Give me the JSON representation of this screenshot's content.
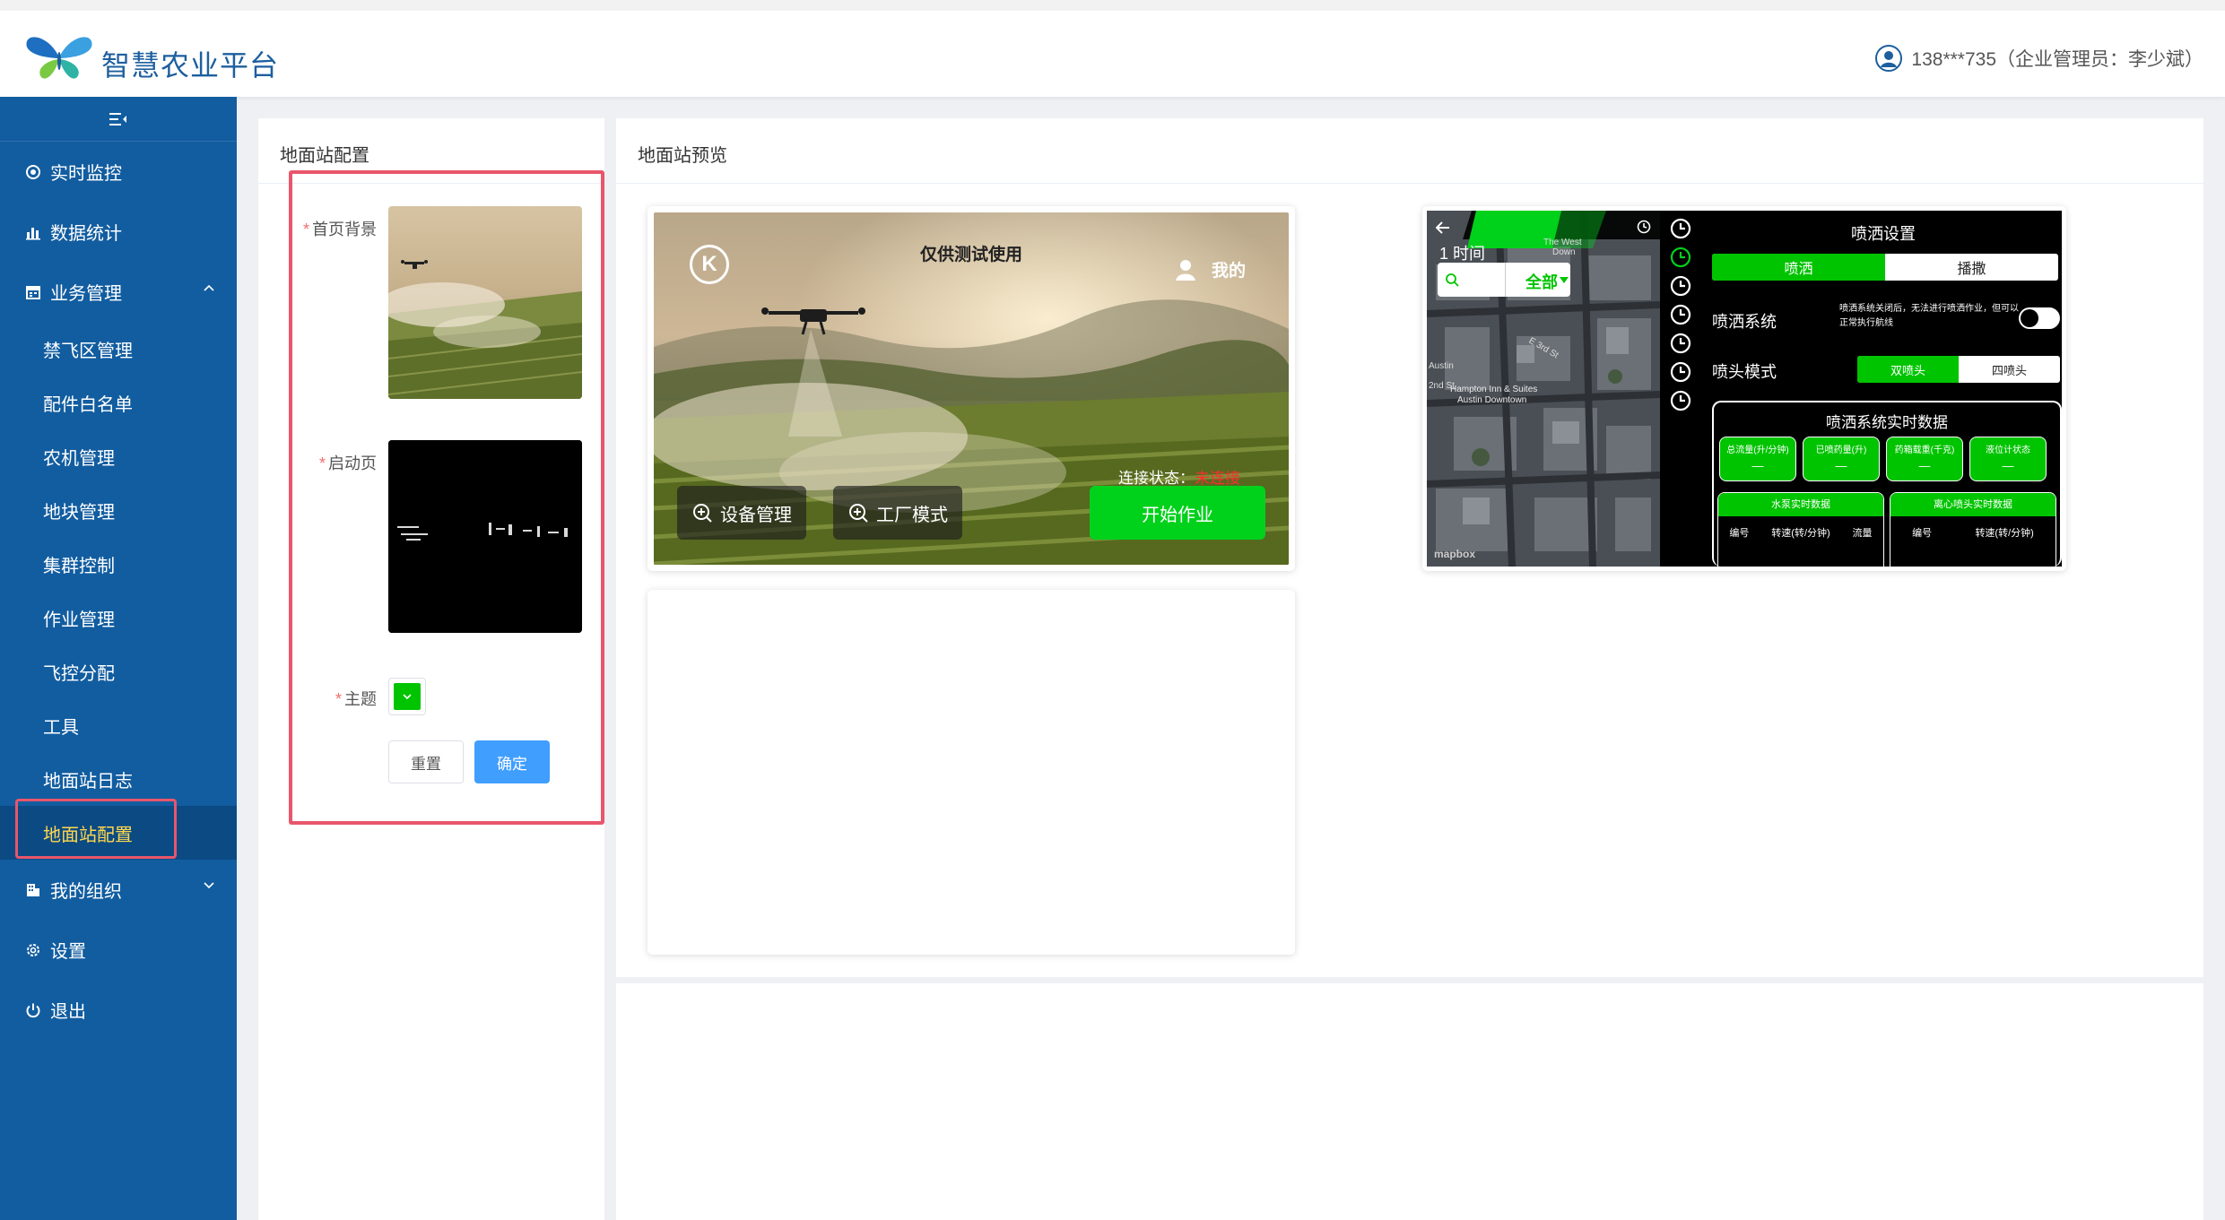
{
  "header": {
    "app_title": "智慧农业平台",
    "user_info": "138***735（企业管理员：李少斌）"
  },
  "sidebar": {
    "menu": [
      {
        "label": "实时监控",
        "icon": "monitor-icon"
      },
      {
        "label": "数据统计",
        "icon": "bar-chart-icon"
      },
      {
        "label": "业务管理",
        "icon": "calendar-icon"
      }
    ],
    "sub_items": [
      "禁飞区管理",
      "配件白名单",
      "农机管理",
      "地块管理",
      "集群控制",
      "作业管理",
      "飞控分配",
      "工具",
      "地面站日志",
      "地面站配置"
    ],
    "active": "地面站配置",
    "bottom_menu": [
      {
        "label": "我的组织",
        "icon": "org-icon"
      },
      {
        "label": "设置",
        "icon": "gear-icon"
      },
      {
        "label": "退出",
        "icon": "power-icon"
      }
    ]
  },
  "config_panel": {
    "title": "地面站配置",
    "home_bg_label": "首页背景",
    "splash_label": "启动页",
    "theme_label": "主题",
    "theme_color": "#00c400",
    "reset_button": "重置",
    "confirm_button": "确定"
  },
  "preview_panel": {
    "title": "地面站预览",
    "preview1": {
      "title": "仅供测试使用",
      "mine": "我的",
      "connection_label": "连接状态：",
      "connection_value": "未连接",
      "device_mgmt": "设备管理",
      "factory_mode": "工厂模式",
      "start_button": "开始作业"
    },
    "preview2": {
      "time_label": "1 时间",
      "filter_all": "全部",
      "map_labels": [
        "The West",
        "Down",
        "Hampton Inn & Suites",
        "Austin Downtown",
        "Austin",
        "2nd St",
        "E 3rd St"
      ],
      "map_brand": "mapbox",
      "title": "喷洒设置",
      "tabs": [
        "喷洒",
        "播撒"
      ],
      "spray_system_label": "喷洒系统",
      "spray_system_hint": "喷洒系统关闭后，无法进行喷洒作业，但可以正常执行航线",
      "nozzle_mode_label": "喷头模式",
      "nozzle_tabs": [
        "双喷头",
        "四喷头"
      ],
      "realtime_title": "喷洒系统实时数据",
      "metrics": [
        {
          "label": "总流量(升/分钟)",
          "value": "—"
        },
        {
          "label": "已喷药量(升)",
          "value": "—"
        },
        {
          "label": "药箱载重(千克)",
          "value": "—"
        },
        {
          "label": "液位计状态",
          "value": "—"
        }
      ],
      "pump_panel": {
        "title": "水泵实时数据",
        "cols": [
          "编号",
          "转速(转/分钟)",
          "流量"
        ]
      },
      "centrifugal_panel": {
        "title": "离心喷头实时数据",
        "cols": [
          "编号",
          "转速(转/分钟)"
        ]
      }
    }
  }
}
